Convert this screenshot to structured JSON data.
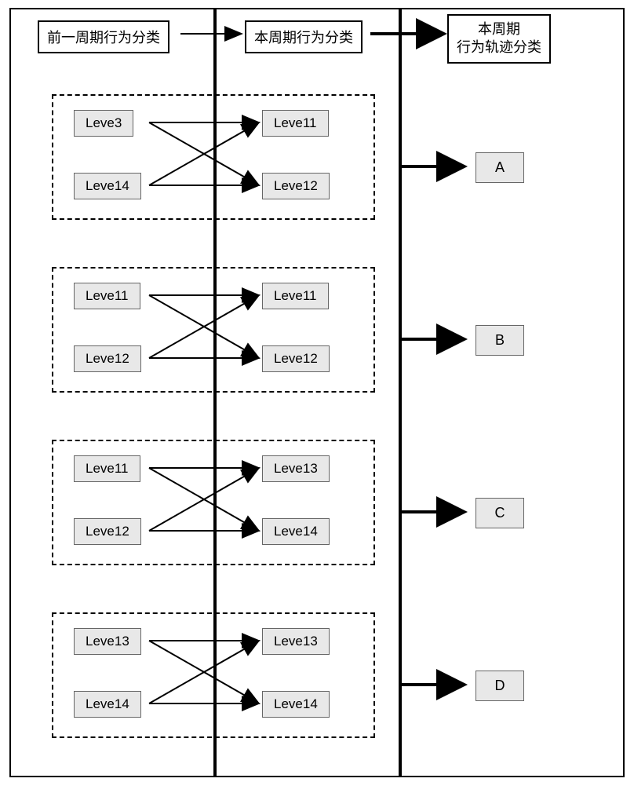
{
  "headers": {
    "col1": "前一周期行为分类",
    "col2": "本周期行为分类",
    "col3_line1": "本周期",
    "col3_line2": "行为轨迹分类"
  },
  "groups": [
    {
      "left": [
        "Leve3",
        "Leve14"
      ],
      "right": [
        "Leve11",
        "Leve12"
      ],
      "result": "A"
    },
    {
      "left": [
        "Leve11",
        "Leve12"
      ],
      "right": [
        "Leve11",
        "Leve12"
      ],
      "result": "B"
    },
    {
      "left": [
        "Leve11",
        "Leve12"
      ],
      "right": [
        "Leve13",
        "Leve14"
      ],
      "result": "C"
    },
    {
      "left": [
        "Leve13",
        "Leve14"
      ],
      "right": [
        "Leve13",
        "Leve14"
      ],
      "result": "D"
    }
  ]
}
